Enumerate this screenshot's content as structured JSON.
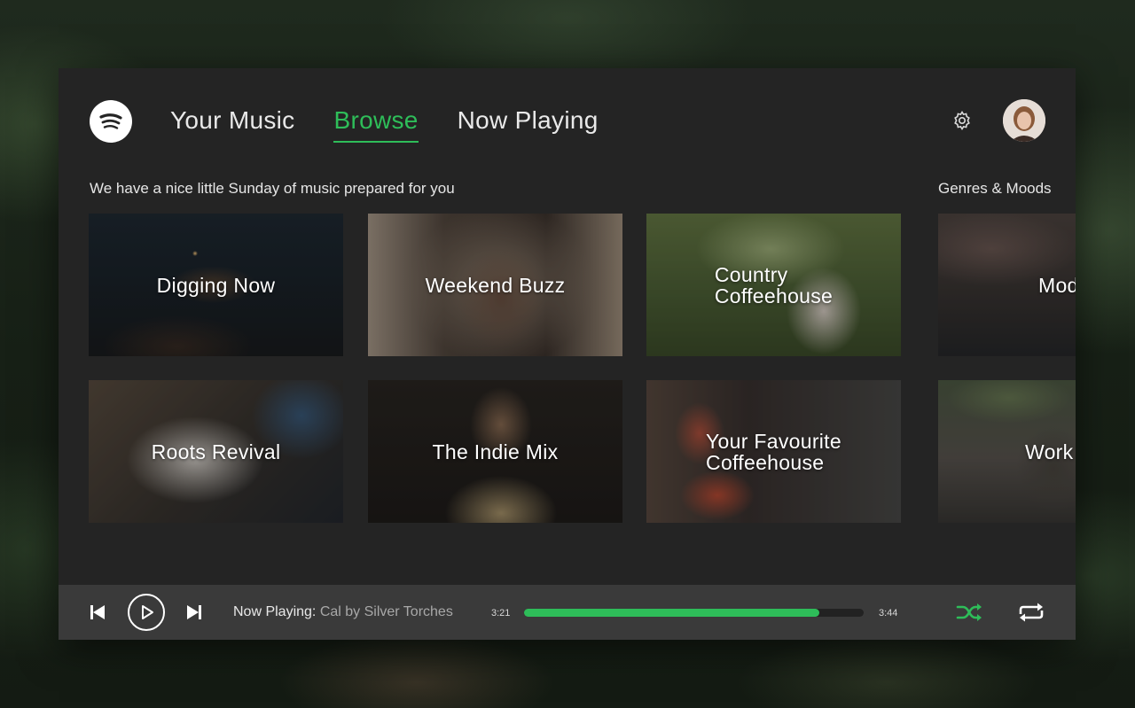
{
  "header": {
    "logo_icon": "spotify-logo-icon",
    "tabs": [
      {
        "label": "Your Music",
        "active": false
      },
      {
        "label": "Browse",
        "active": true
      },
      {
        "label": "Now Playing",
        "active": false
      }
    ],
    "settings_icon": "gear-icon",
    "avatar_icon": "user-avatar"
  },
  "main": {
    "section_title": "We have a nice little Sunday of music prepared for you",
    "genres_title": "Genres & Moods",
    "tiles": [
      {
        "label": "Digging Now"
      },
      {
        "label": "Weekend Buzz"
      },
      {
        "label": "Country\nCoffeehouse"
      },
      {
        "label": "Mod"
      },
      {
        "label": "Roots Revival"
      },
      {
        "label": "The Indie Mix"
      },
      {
        "label": "Your Favourite\nCoffeehouse"
      },
      {
        "label": "Work"
      }
    ]
  },
  "player": {
    "now_playing_label": "Now Playing:",
    "track": "Cal by Silver Torches",
    "current_time": "3:21",
    "total_time": "3:44",
    "progress": 0.87,
    "shuffle_active": true,
    "accent_color": "#2ebd59",
    "icons": [
      "skip-previous-icon",
      "play-icon",
      "skip-next-icon",
      "shuffle-icon",
      "repeat-icon"
    ]
  }
}
